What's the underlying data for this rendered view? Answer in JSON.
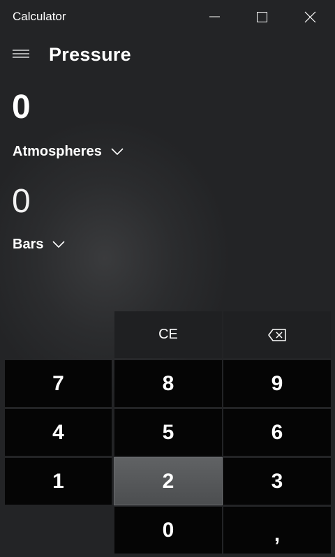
{
  "window": {
    "title": "Calculator",
    "controls": [
      "minimize-icon",
      "maximize-icon",
      "close-icon"
    ]
  },
  "header": {
    "menu_icon": "hamburger-menu-icon",
    "mode_title": "Pressure"
  },
  "converter": {
    "from": {
      "value": "0",
      "unit": "Atmospheres"
    },
    "to": {
      "value": "0",
      "unit": "Bars"
    }
  },
  "keypad": {
    "ce": "CE",
    "backspace_icon": "backspace-icon",
    "digits": {
      "seven": "7",
      "eight": "8",
      "nine": "9",
      "four": "4",
      "five": "5",
      "six": "6",
      "one": "1",
      "two": "2",
      "three": "3",
      "zero": "0"
    },
    "decimal": ",",
    "pressed_key": "2"
  },
  "colors": {
    "background": "#2b2c2e",
    "digit_key": "#050505",
    "function_key": "#1f2022",
    "pressed_key": "#545658",
    "text": "#ffffff"
  }
}
